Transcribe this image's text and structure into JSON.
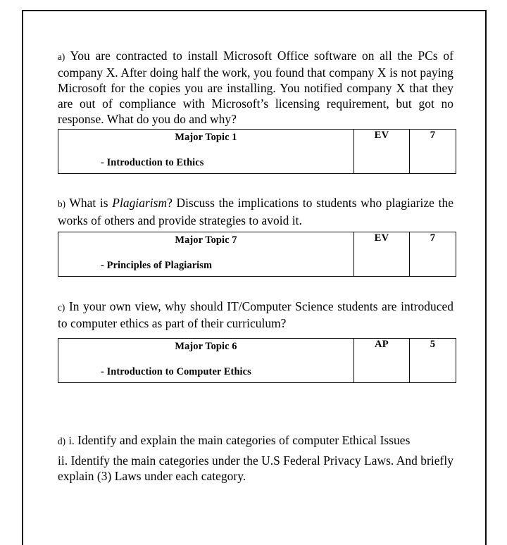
{
  "document": {
    "page_border_color": "#0a0a0a",
    "background_color": "#ffffff",
    "text_color": "#000000"
  },
  "questions": [
    {
      "marker": "a)",
      "text": "You are contracted to install Microsoft Office software on all the PCs of company X. After doing half the work, you found that company X is not paying Microsoft for the copies you are installing. You notified company X that they are out of compliance with Microsoft’s licensing requirement, but got no response. What do you do and why?",
      "table": {
        "topic_title": "Major Topic 1",
        "topic_sub": "- Introduction to Ethics",
        "code": "EV",
        "marks": "7"
      }
    },
    {
      "marker": "b)",
      "text_part1": "What is ",
      "text_italic": "Plagiarism",
      "text_part2": "? Discuss the implications to students who plagiarize the works of others and provide strategies to avoid it.",
      "table": {
        "topic_title": "Major Topic 7",
        "topic_sub": "- Principles of Plagiarism",
        "code": "EV",
        "marks": "7"
      }
    },
    {
      "marker": "c)",
      "text": "In your own view, why should IT/Computer Science students are introduced to computer ethics as part of their curriculum?",
      "table": {
        "topic_title": "Major Topic 6",
        "topic_sub": "- Introduction to Computer Ethics",
        "code": "AP",
        "marks": "5"
      }
    },
    {
      "marker": "d)",
      "sub_marker_i": "i.",
      "text_i": "Identify and explain the main categories of computer Ethical Issues",
      "sub_marker_ii": "ii.",
      "text_ii": "Identify the main categories under the U.S Federal Privacy Laws. And briefly explain (3) Laws under each category."
    }
  ]
}
